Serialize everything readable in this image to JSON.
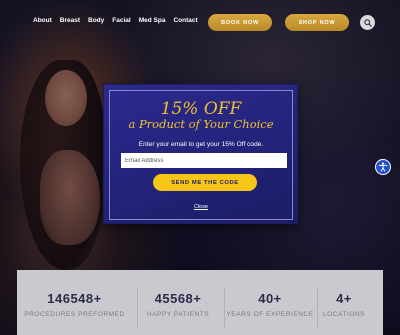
{
  "nav": {
    "links": [
      "About",
      "Breast",
      "Body",
      "Facial",
      "Med Spa",
      "Contact"
    ],
    "book_label": "BOOK NOW",
    "shop_label": "SHOP NOW",
    "search_icon": "search-icon"
  },
  "popup": {
    "title": "15% OFF",
    "subtitle": "a Product of Your Choice",
    "prompt": "Enter your email to get your 15% Off code.",
    "email_placeholder": "Email Address",
    "send_label": "SEND ME THE CODE",
    "close_label": "Close"
  },
  "accessibility": {
    "icon": "accessibility-icon"
  },
  "stats": [
    {
      "value": "146548+",
      "label": "PROCEDURES PREFORMED"
    },
    {
      "value": "45568+",
      "label": "HAPPY PATIENTS"
    },
    {
      "value": "40+",
      "label": "YEARS OF EXPERIENCE"
    },
    {
      "value": "4+",
      "label": "LOCATIONS"
    }
  ],
  "colors": {
    "accent_gold": "#d8a93e",
    "popup_blue": "#23237a",
    "popup_yellow": "#f2c12e",
    "send_button": "#f5c518",
    "stats_bg": "#c9c9cf"
  }
}
